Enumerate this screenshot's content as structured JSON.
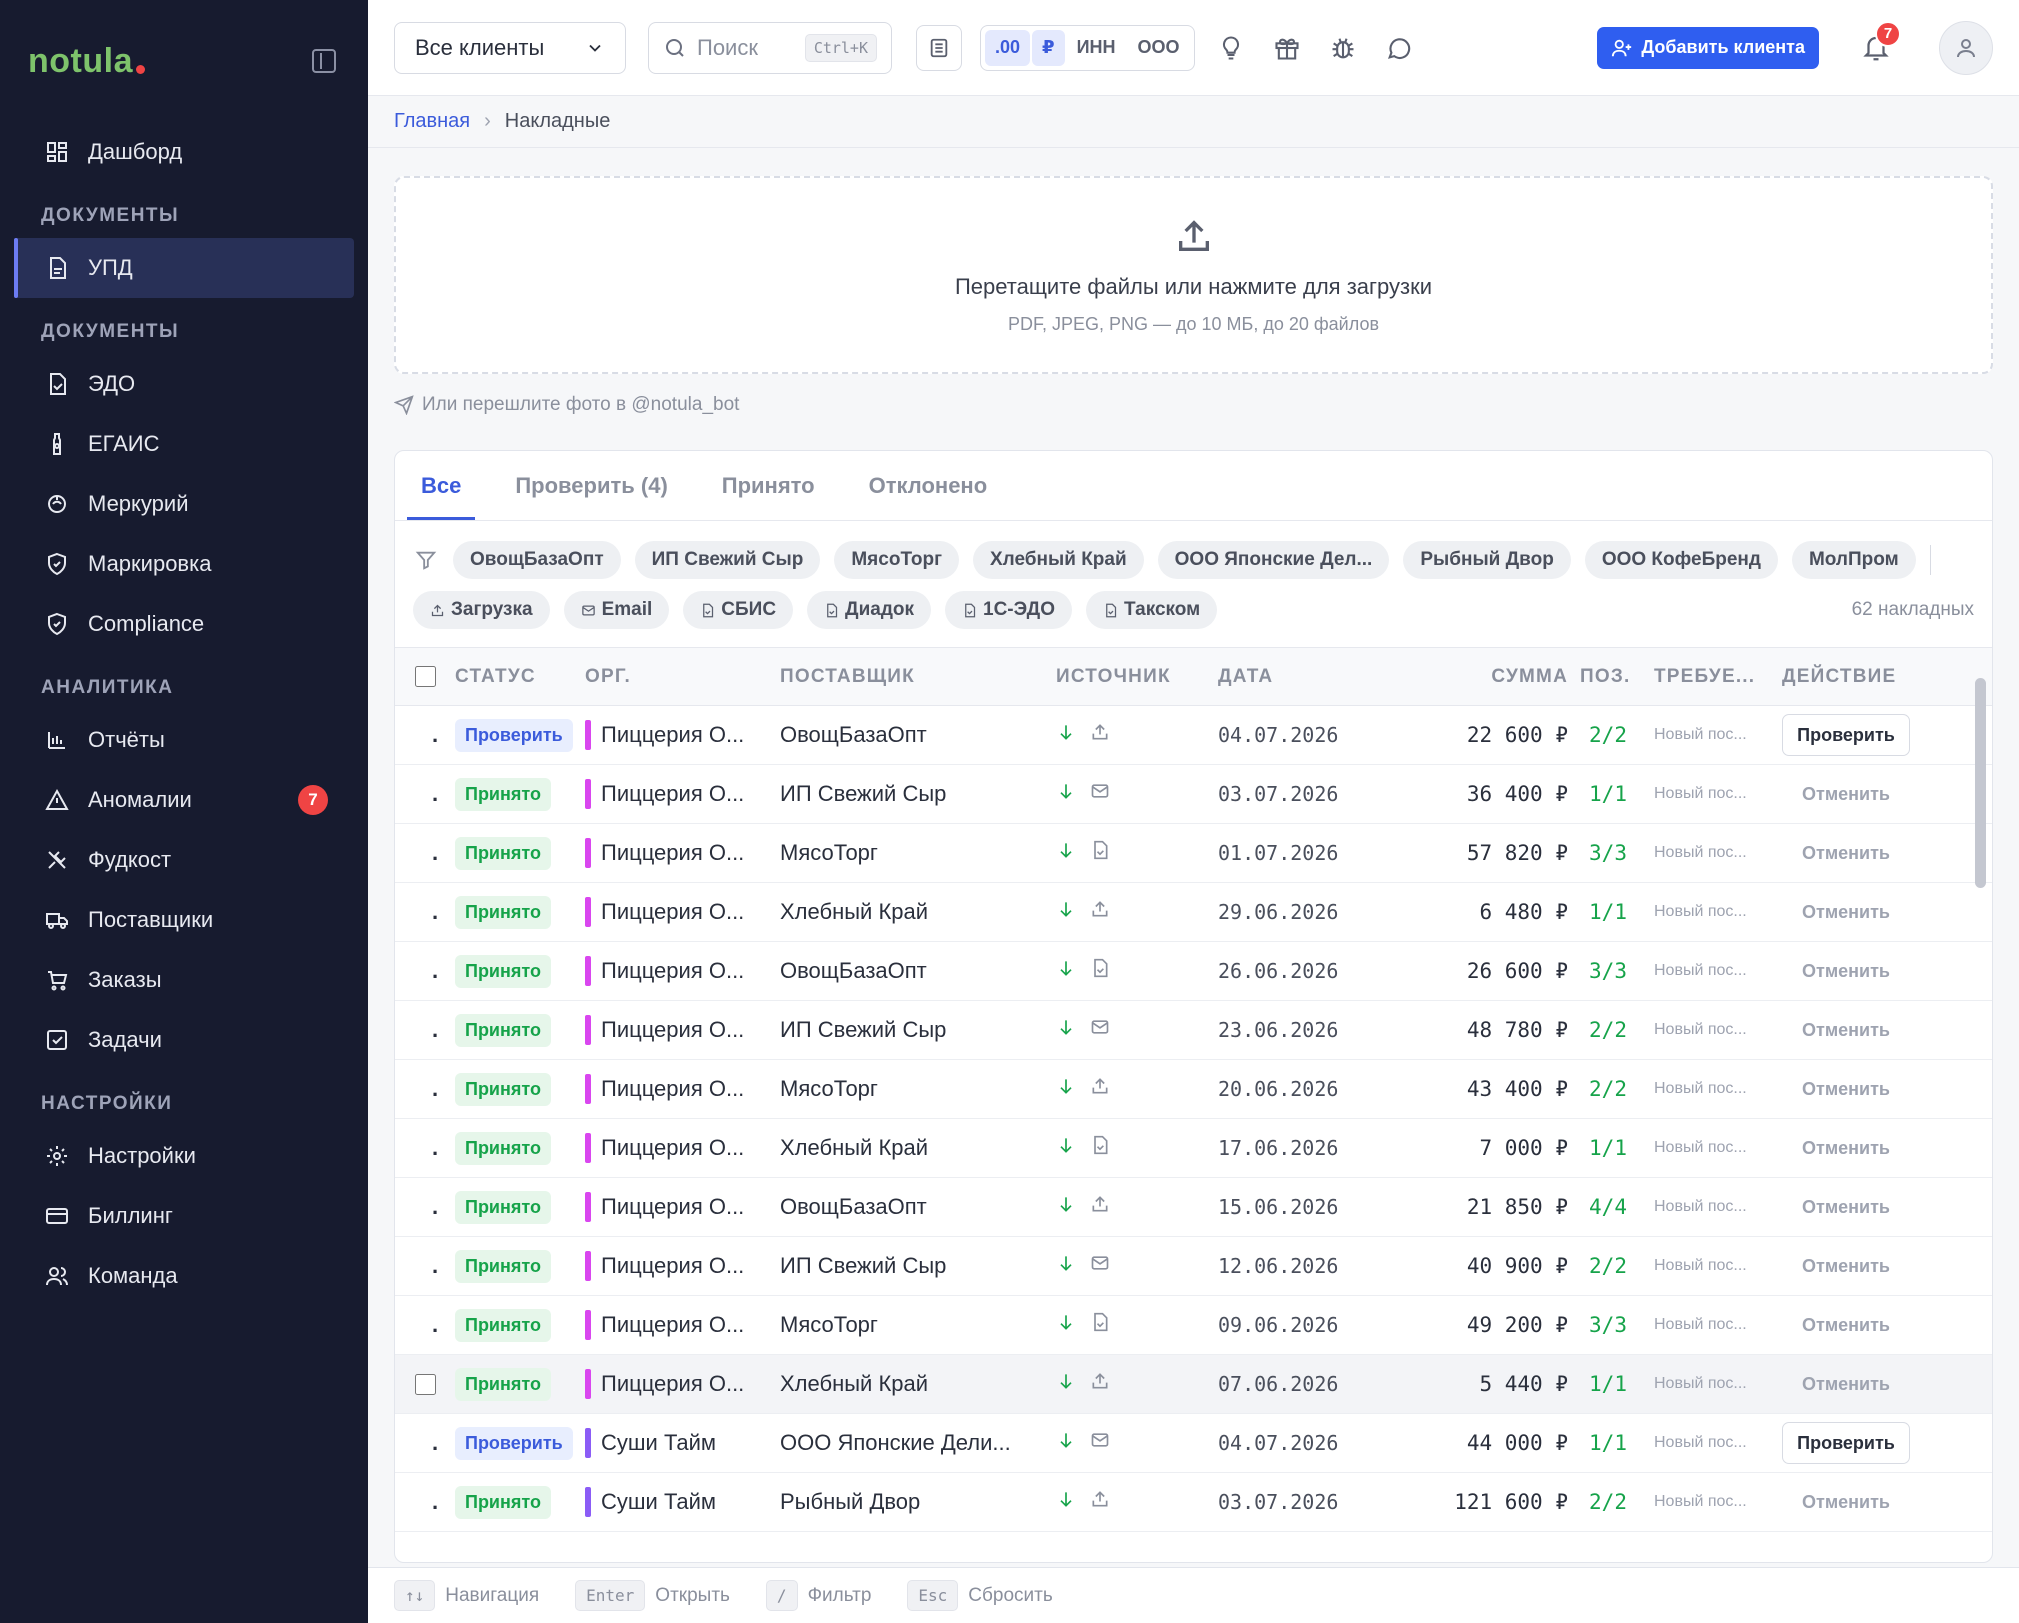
{
  "logo": "notula",
  "sidebar": {
    "items": [
      {
        "label": "Дашборд",
        "icon": "dashboard-icon"
      },
      {
        "section": "ДОКУМЕНТЫ"
      },
      {
        "label": "УПД",
        "icon": "document-icon",
        "active": true
      },
      {
        "section": "ДОКУМЕНТЫ"
      },
      {
        "label": "ЭДО",
        "icon": "edo-icon"
      },
      {
        "label": "ЕГАИС",
        "icon": "bottle-icon"
      },
      {
        "label": "Меркурий",
        "icon": "mercury-icon"
      },
      {
        "label": "Маркировка",
        "icon": "shield-icon"
      },
      {
        "label": "Compliance",
        "icon": "shield-check-icon"
      },
      {
        "section": "АНАЛИТИКА"
      },
      {
        "label": "Отчёты",
        "icon": "bar-chart-icon"
      },
      {
        "label": "Аномалии",
        "icon": "alert-icon",
        "badge": "7"
      },
      {
        "label": "Фудкост",
        "icon": "utensils-icon"
      },
      {
        "label": "Поставщики",
        "icon": "truck-icon"
      },
      {
        "label": "Заказы",
        "icon": "cart-icon"
      },
      {
        "label": "Задачи",
        "icon": "checkbox-icon"
      },
      {
        "section": "НАСТРОЙКИ"
      },
      {
        "label": "Настройки",
        "icon": "gear-icon"
      },
      {
        "label": "Биллинг",
        "icon": "card-icon"
      },
      {
        "label": "Команда",
        "icon": "users-icon"
      }
    ]
  },
  "topbar": {
    "client_select": "Все клиенты",
    "search_placeholder": "Поиск",
    "search_shortcut": "Ctrl+K",
    "formats": [
      ".00",
      "₽",
      "ИНН",
      "ООО"
    ],
    "add_client": "Добавить клиента",
    "notifications": "7"
  },
  "breadcrumb": {
    "home": "Главная",
    "current": "Накладные"
  },
  "dropzone": {
    "title": "Перетащите файлы или нажмите для загрузки",
    "subtitle": "PDF, JPEG, PNG — до 10 МБ, до 20 файлов",
    "telegram_hint": "Или перешлите фото в @notula_bot"
  },
  "tabs": [
    "Все",
    "Проверить (4)",
    "Принято",
    "Отклонено"
  ],
  "supplier_chips": [
    "ОвощБазаОпт",
    "ИП Свежий Сыр",
    "МясоТорг",
    "Хлебный Край",
    "ООО Японские Дел...",
    "Рыбный Двор",
    "ООО КофеБренд",
    "МолПром"
  ],
  "source_chips": [
    "Загрузка",
    "Email",
    "СБИС",
    "Диадок",
    "1С-ЭДО",
    "Такском"
  ],
  "count_label": "62 накладных",
  "columns": {
    "status": "СТАТУС",
    "org": "ОРГ.",
    "supplier": "ПОСТАВЩИК",
    "source": "ИСТОЧНИК",
    "date": "ДАТА",
    "sum": "СУММА",
    "pos": "ПОЗ.",
    "req": "ТРЕБУЕ...",
    "action": "ДЕЙСТВИЕ"
  },
  "rows": [
    {
      "status": "Проверить",
      "kind": "check",
      "org": "Пиццерия О...",
      "org_color": "#d946ef",
      "supplier": "ОвощБазаОпт",
      "src": "upload",
      "date": "04.07.2026",
      "sum": "22 600 ₽",
      "pos": "2/2",
      "req": "Новый пос...",
      "action": "Проверить"
    },
    {
      "status": "Принято",
      "kind": "ok",
      "org": "Пиццерия О...",
      "org_color": "#d946ef",
      "supplier": "ИП Свежий Сыр",
      "src": "email",
      "date": "03.07.2026",
      "sum": "36 400 ₽",
      "pos": "1/1",
      "req": "Новый пос...",
      "action": "Отменить"
    },
    {
      "status": "Принято",
      "kind": "ok",
      "org": "Пиццерия О...",
      "org_color": "#d946ef",
      "supplier": "МясоТорг",
      "src": "doc",
      "date": "01.07.2026",
      "sum": "57 820 ₽",
      "pos": "3/3",
      "req": "Новый пос...",
      "action": "Отменить"
    },
    {
      "status": "Принято",
      "kind": "ok",
      "org": "Пиццерия О...",
      "org_color": "#d946ef",
      "supplier": "Хлебный Край",
      "src": "upload",
      "date": "29.06.2026",
      "sum": "6 480 ₽",
      "pos": "1/1",
      "req": "Новый пос...",
      "action": "Отменить"
    },
    {
      "status": "Принято",
      "kind": "ok",
      "org": "Пиццерия О...",
      "org_color": "#d946ef",
      "supplier": "ОвощБазаОпт",
      "src": "doc",
      "date": "26.06.2026",
      "sum": "26 600 ₽",
      "pos": "3/3",
      "req": "Новый пос...",
      "action": "Отменить"
    },
    {
      "status": "Принято",
      "kind": "ok",
      "org": "Пиццерия О...",
      "org_color": "#d946ef",
      "supplier": "ИП Свежий Сыр",
      "src": "email",
      "date": "23.06.2026",
      "sum": "48 780 ₽",
      "pos": "2/2",
      "req": "Новый пос...",
      "action": "Отменить"
    },
    {
      "status": "Принято",
      "kind": "ok",
      "org": "Пиццерия О...",
      "org_color": "#d946ef",
      "supplier": "МясоТорг",
      "src": "upload",
      "date": "20.06.2026",
      "sum": "43 400 ₽",
      "pos": "2/2",
      "req": "Новый пос...",
      "action": "Отменить"
    },
    {
      "status": "Принято",
      "kind": "ok",
      "org": "Пиццерия О...",
      "org_color": "#d946ef",
      "supplier": "Хлебный Край",
      "src": "doc",
      "date": "17.06.2026",
      "sum": "7 000 ₽",
      "pos": "1/1",
      "req": "Новый пос...",
      "action": "Отменить"
    },
    {
      "status": "Принято",
      "kind": "ok",
      "org": "Пиццерия О...",
      "org_color": "#d946ef",
      "supplier": "ОвощБазаОпт",
      "src": "upload",
      "date": "15.06.2026",
      "sum": "21 850 ₽",
      "pos": "4/4",
      "req": "Новый пос...",
      "action": "Отменить"
    },
    {
      "status": "Принято",
      "kind": "ok",
      "org": "Пиццерия О...",
      "org_color": "#d946ef",
      "supplier": "ИП Свежий Сыр",
      "src": "email",
      "date": "12.06.2026",
      "sum": "40 900 ₽",
      "pos": "2/2",
      "req": "Новый пос...",
      "action": "Отменить"
    },
    {
      "status": "Принято",
      "kind": "ok",
      "org": "Пиццерия О...",
      "org_color": "#d946ef",
      "supplier": "МясоТорг",
      "src": "doc",
      "date": "09.06.2026",
      "sum": "49 200 ₽",
      "pos": "3/3",
      "req": "Новый пос...",
      "action": "Отменить"
    },
    {
      "status": "Принято",
      "kind": "ok",
      "org": "Пиццерия О...",
      "org_color": "#d946ef",
      "supplier": "Хлебный Край",
      "src": "upload",
      "date": "07.06.2026",
      "sum": "5 440 ₽",
      "pos": "1/1",
      "req": "Новый пос...",
      "action": "Отменить",
      "hover": true
    },
    {
      "status": "Проверить",
      "kind": "check",
      "org": "Суши Тайм",
      "org_color": "#8b5cf6",
      "supplier": "ООО Японские Дели...",
      "src": "email",
      "date": "04.07.2026",
      "sum": "44 000 ₽",
      "pos": "1/1",
      "req": "Новый пос...",
      "action": "Проверить"
    },
    {
      "status": "Принято",
      "kind": "ok",
      "org": "Суши Тайм",
      "org_color": "#8b5cf6",
      "supplier": "Рыбный Двор",
      "src": "upload",
      "date": "03.07.2026",
      "sum": "121 600 ₽",
      "pos": "2/2",
      "req": "Новый пос...",
      "action": "Отменить"
    }
  ],
  "footer": [
    {
      "key": "↑↓",
      "label": "Навигация"
    },
    {
      "key": "Enter",
      "label": "Открыть"
    },
    {
      "key": "/",
      "label": "Фильтр"
    },
    {
      "key": "Esc",
      "label": "Сбросить"
    }
  ]
}
